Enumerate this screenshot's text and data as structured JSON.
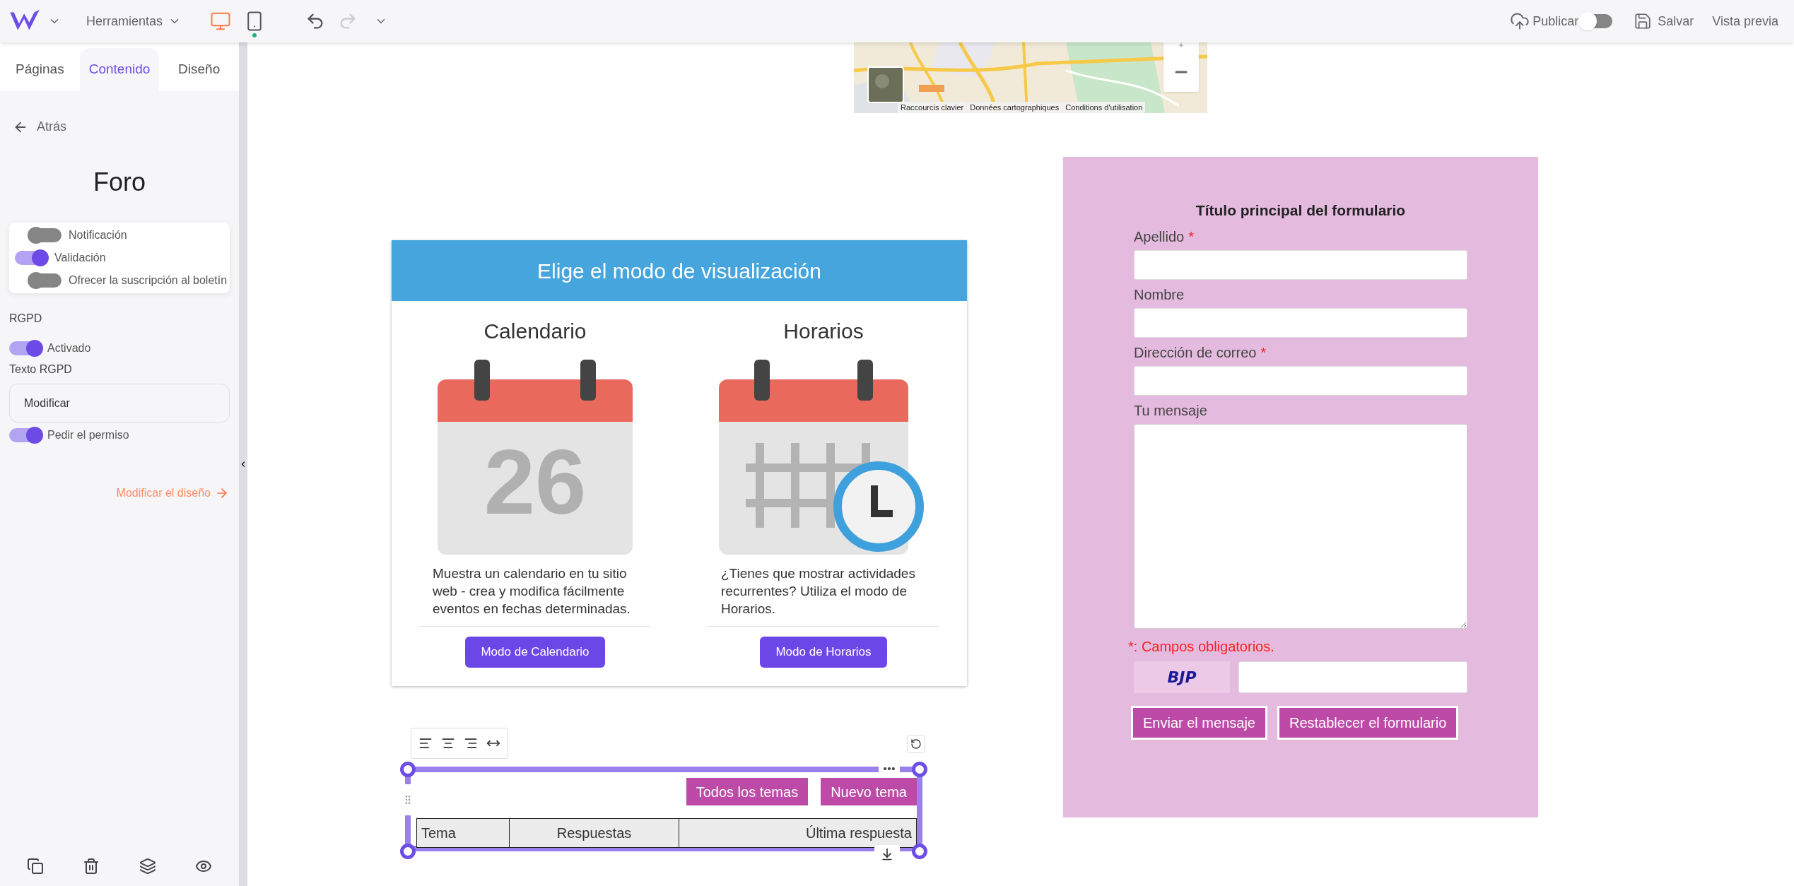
{
  "topbar": {
    "tools_menu": "Herramientas",
    "devices": [
      {
        "kind": "desktop",
        "selected": true
      },
      {
        "kind": "mobile",
        "selected": false
      }
    ],
    "publish": {
      "label": "Publicar",
      "on": false
    },
    "save": "Salvar",
    "preview": "Vista previa"
  },
  "sidebar": {
    "tabs": [
      {
        "label": "Páginas",
        "selected": false
      },
      {
        "label": "Contenido",
        "selected": true
      },
      {
        "label": "Diseño",
        "selected": false
      }
    ],
    "back": "Atrás",
    "title": "Foro",
    "options": [
      {
        "label": "Notificación",
        "on": false
      },
      {
        "label": "Validación",
        "on": true
      },
      {
        "label": "Ofrecer la suscripción al boletín",
        "on": false
      }
    ],
    "gdpr_heading": "RGPD",
    "gdpr_toggle": {
      "label": "Activado",
      "on": true
    },
    "gdpr_text_label": "Texto RGPD",
    "gdpr_text_button": "Modificar",
    "permission": {
      "label": "Pedir el permiso",
      "on": true
    },
    "design_link": "Modificar el diseño"
  },
  "map": {
    "kind": "picture",
    "links": [
      "Raccourcis clavier",
      "Données cartographiques",
      "Conditions d'utilisation"
    ]
  },
  "display_mode": {
    "title": "Elige el modo de visualización",
    "options": [
      {
        "kind": "calendar",
        "heading": "Calendario",
        "day": "26",
        "description": "Muestra un calendario en tu sitio web - crea y modifica fácilmente eventos en fechas determinadas.",
        "button": "Modo de Calendario"
      },
      {
        "kind": "schedule",
        "heading": "Horarios",
        "description": "¿Tienes que mostrar actividades recurrentes? Utiliza el modo de Horarios.",
        "button": "Modo de Horarios"
      }
    ]
  },
  "form": {
    "title": "Título principal del formulario",
    "required_mark": "*",
    "fields": [
      {
        "label": "Apellido",
        "required": true,
        "kind": "text"
      },
      {
        "label": "Nombre",
        "required": false,
        "kind": "text"
      },
      {
        "label": "Dirección de correo",
        "required": true,
        "kind": "text"
      },
      {
        "label": "Tu mensaje",
        "required": false,
        "kind": "textarea"
      }
    ],
    "required_note": "*: Campos obligatorios.",
    "captcha": "BJP",
    "buttons": [
      "Enviar el mensaje",
      "Restablecer el formulario"
    ]
  },
  "forum": {
    "buttons": [
      "Todos los temas",
      "Nuevo tema"
    ],
    "columns": [
      "Tema",
      "Respuestas",
      "Última respuesta"
    ]
  }
}
